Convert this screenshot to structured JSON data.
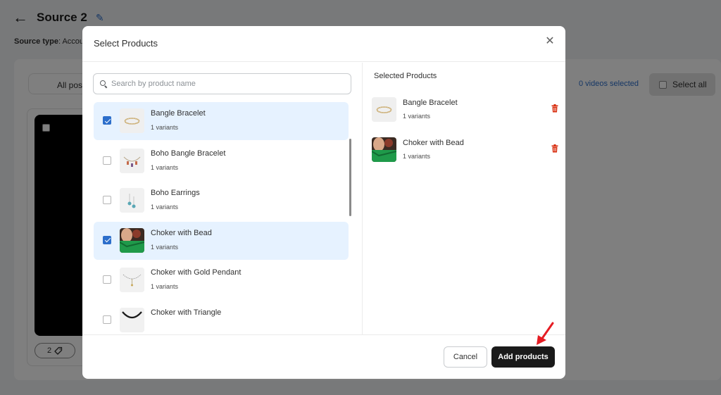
{
  "background": {
    "title": "Source 2",
    "source_type_label": "Source type",
    "source_type_value": ": Accou",
    "tab_label": "All post",
    "videos_selected": "0 videos selected",
    "select_all": "Select all",
    "tag_count": "2"
  },
  "modal": {
    "title": "Select Products",
    "search": {
      "placeholder": "Search by product name",
      "value": ""
    },
    "products": [
      {
        "name": "Bangle Bracelet",
        "variants": "1 variants",
        "checked": true
      },
      {
        "name": "Boho Bangle Bracelet",
        "variants": "1 variants",
        "checked": false
      },
      {
        "name": "Boho Earrings",
        "variants": "1 variants",
        "checked": false
      },
      {
        "name": "Choker with Bead",
        "variants": "1 variants",
        "checked": true
      },
      {
        "name": "Choker with Gold Pendant",
        "variants": "1 variants",
        "checked": false
      },
      {
        "name": "Choker with Triangle",
        "variants": "",
        "checked": false
      }
    ],
    "selected_title": "Selected Products",
    "selected": [
      {
        "name": "Bangle Bracelet",
        "variants": "1 variants"
      },
      {
        "name": "Choker with Bead",
        "variants": "1 variants"
      }
    ],
    "cancel_label": "Cancel",
    "add_label": "Add products"
  },
  "colors": {
    "accent_blue": "#2c6ecb",
    "selected_row_bg": "#e6f2ff",
    "primary_button": "#1a1a1a",
    "trash_red": "#d82c0d",
    "annotation_arrow": "#e51c23"
  }
}
